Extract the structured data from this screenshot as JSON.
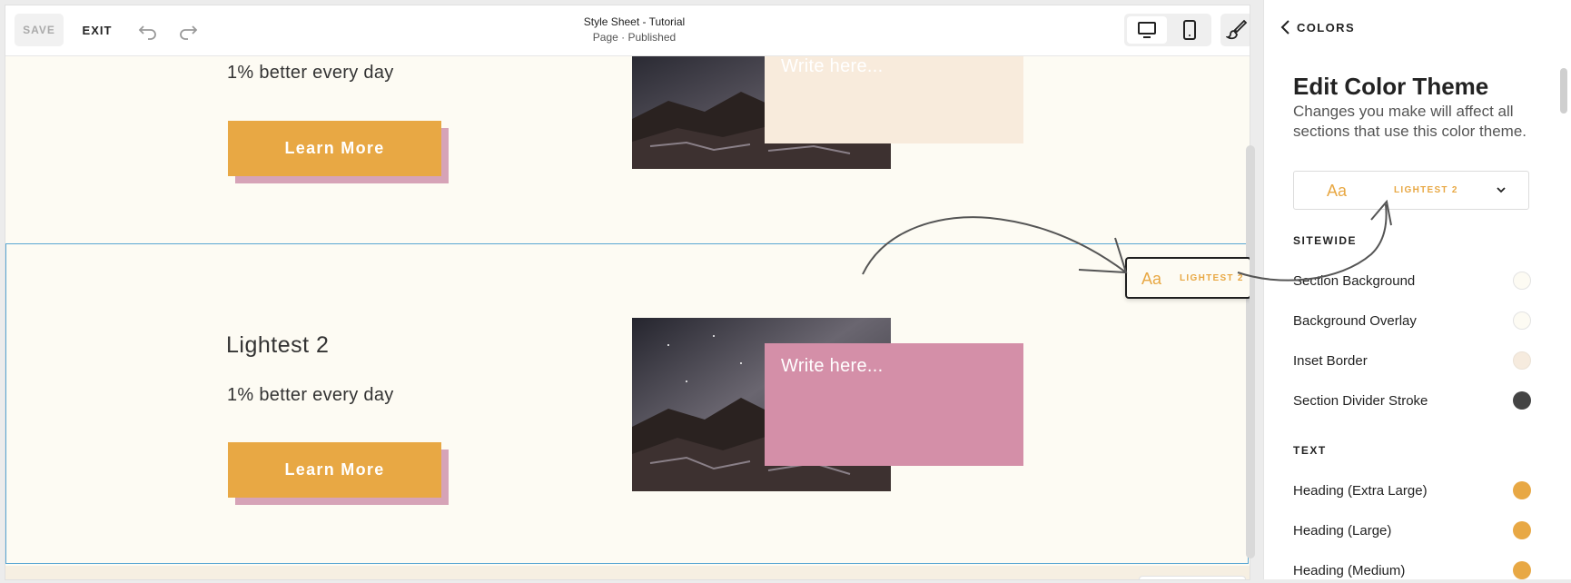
{
  "toolbar": {
    "save_label": "SAVE",
    "exit_label": "EXIT",
    "doc_title": "Style Sheet - Tutorial",
    "doc_subtitle": "Page · Published"
  },
  "canvas": {
    "top_section": {
      "subline": "1% better every day",
      "cta": "Learn More",
      "textbox": "Write here..."
    },
    "selected_section": {
      "heading": "Lightest 2",
      "subline": "1% better every day",
      "cta": "Learn More",
      "textbox": "Write here..."
    },
    "pill": {
      "aa": "Aa",
      "label": "LIGHTEST 2"
    }
  },
  "panel": {
    "back_label": "COLORS",
    "title": "Edit Color Theme",
    "description": "Changes you make will affect all sections that use this color theme.",
    "theme_select": {
      "aa": "Aa",
      "label": "LIGHTEST 2"
    },
    "groups": [
      {
        "label": "SITEWIDE",
        "items": [
          {
            "label": "Section Background",
            "color": "#fdfbf3"
          },
          {
            "label": "Background Overlay",
            "color": "#fdfbf3"
          },
          {
            "label": "Inset Border",
            "color": "#f6ebde"
          },
          {
            "label": "Section Divider Stroke",
            "color": "#444444"
          }
        ]
      },
      {
        "label": "TEXT",
        "items": [
          {
            "label": "Heading (Extra Large)",
            "color": "#e8a844"
          },
          {
            "label": "Heading (Large)",
            "color": "#e8a844"
          },
          {
            "label": "Heading (Medium)",
            "color": "#e8a844"
          }
        ]
      }
    ]
  },
  "colors": {
    "accent": "#e8a844",
    "cta_shadow": "#d6a3b7",
    "textbox_peach": "#f8ebdc",
    "textbox_pink": "#d48fa8",
    "selection_border": "#5aa7d3"
  },
  "icons": [
    "undo-icon",
    "redo-icon",
    "desktop-icon",
    "mobile-icon",
    "paintbrush-icon",
    "chevron-left-icon",
    "chevron-down-icon"
  ]
}
